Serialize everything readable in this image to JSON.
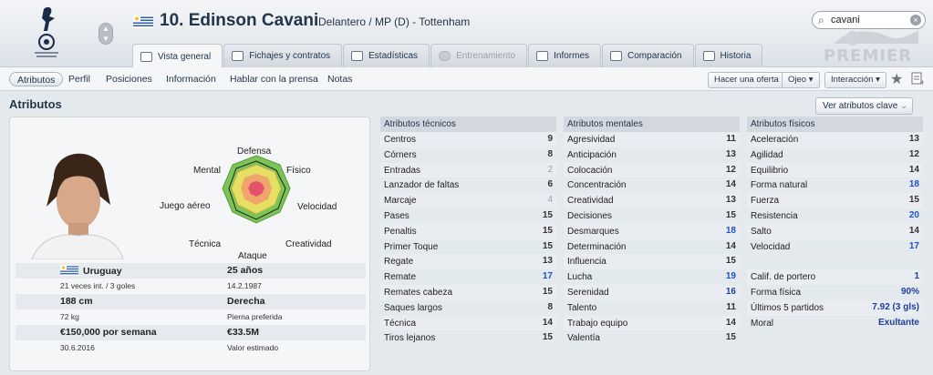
{
  "header": {
    "player_title": "10. Edinson Cavani",
    "player_subtitle": "Delantero / MP (D) - Tottenham",
    "search_value": "cavani",
    "logo_text": "PREMIER"
  },
  "tabs": [
    {
      "label": "Vista general"
    },
    {
      "label": "Fichajes y contratos"
    },
    {
      "label": "Estadísticas"
    },
    {
      "label": "Entrenamiento"
    },
    {
      "label": "Informes"
    },
    {
      "label": "Comparación"
    },
    {
      "label": "Historia"
    }
  ],
  "subnav": {
    "items": [
      "Atributos",
      "Perfil",
      "Posiciones",
      "Información",
      "Hablar con la prensa",
      "Notas"
    ],
    "make_offer": "Hacer una oferta",
    "scout": "Ojeo",
    "interaction": "Interacción"
  },
  "section": {
    "title": "Atributos",
    "key_attributes_button": "Ver atributos clave"
  },
  "radar_labels": {
    "defense": "Defensa",
    "physical": "Físico",
    "speed": "Velocidad",
    "creativity": "Creatividad",
    "attack": "Ataque",
    "technique": "Técnica",
    "aerial": "Juego aéreo",
    "mental": "Mental"
  },
  "info": {
    "nationality": "Uruguay",
    "caps": "21 veces int. / 3 goles",
    "age": "25 años",
    "dob": "14.2.1987",
    "height": "188 cm",
    "weight": "72 kg",
    "foot": "Derecha",
    "foot_label": "Pierna preferida",
    "wage": "€150,000 por semana",
    "contract_end": "30.6.2016",
    "value": "€33.5M",
    "value_label": "Valor estimado"
  },
  "technical": {
    "header": "Atributos técnicos",
    "rows": [
      {
        "name": "Centros",
        "value": "9"
      },
      {
        "name": "Córners",
        "value": "8"
      },
      {
        "name": "Entradas",
        "value": "2"
      },
      {
        "name": "Lanzador de faltas",
        "value": "6"
      },
      {
        "name": "Marcaje",
        "value": "4"
      },
      {
        "name": "Pases",
        "value": "15"
      },
      {
        "name": "Penaltis",
        "value": "15"
      },
      {
        "name": "Primer Toque",
        "value": "15"
      },
      {
        "name": "Regate",
        "value": "13"
      },
      {
        "name": "Remate",
        "value": "17"
      },
      {
        "name": "Remates cabeza",
        "value": "15"
      },
      {
        "name": "Saques largos",
        "value": "8"
      },
      {
        "name": "Técnica",
        "value": "14"
      },
      {
        "name": "Tiros lejanos",
        "value": "15"
      }
    ]
  },
  "mental": {
    "header": "Atributos mentales",
    "rows": [
      {
        "name": "Agresividad",
        "value": "11"
      },
      {
        "name": "Anticipación",
        "value": "13"
      },
      {
        "name": "Colocación",
        "value": "12"
      },
      {
        "name": "Concentración",
        "value": "14"
      },
      {
        "name": "Creatividad",
        "value": "13"
      },
      {
        "name": "Decisiones",
        "value": "15"
      },
      {
        "name": "Desmarques",
        "value": "18"
      },
      {
        "name": "Determinación",
        "value": "14"
      },
      {
        "name": "Influencia",
        "value": "15"
      },
      {
        "name": "Lucha",
        "value": "19"
      },
      {
        "name": "Serenidad",
        "value": "16"
      },
      {
        "name": "Talento",
        "value": "11"
      },
      {
        "name": "Trabajo equipo",
        "value": "14"
      },
      {
        "name": "Valentía",
        "value": "15"
      }
    ]
  },
  "physical": {
    "header": "Atributos físicos",
    "rows": [
      {
        "name": "Aceleración",
        "value": "13"
      },
      {
        "name": "Agilidad",
        "value": "12"
      },
      {
        "name": "Equilibrio",
        "value": "14"
      },
      {
        "name": "Forma natural",
        "value": "18"
      },
      {
        "name": "Fuerza",
        "value": "15"
      },
      {
        "name": "Resistencia",
        "value": "20"
      },
      {
        "name": "Salto",
        "value": "14"
      },
      {
        "name": "Velocidad",
        "value": "17"
      }
    ]
  },
  "extras": {
    "rows": [
      {
        "name": "Calif. de portero",
        "value": "1"
      },
      {
        "name": "Forma física",
        "value": "90%"
      },
      {
        "name": "Últimos 5 partidos",
        "value": "7.92 (3 gls)"
      },
      {
        "name": "Moral",
        "value": "Exultante"
      }
    ]
  }
}
